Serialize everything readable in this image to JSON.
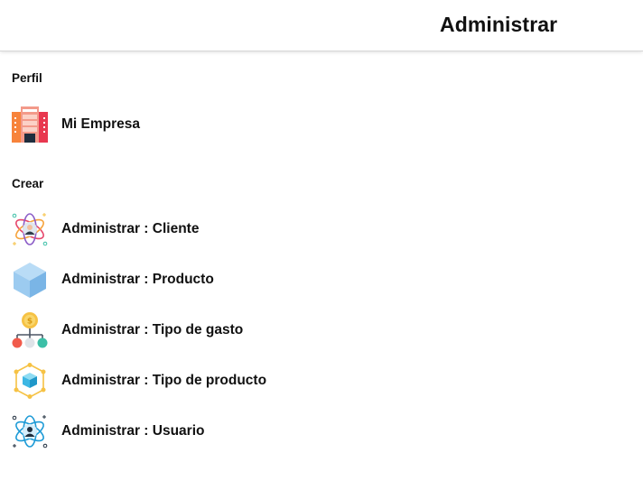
{
  "appbar": {
    "title": "Administrar"
  },
  "sections": {
    "perfil": {
      "header": "Perfil",
      "items": [
        {
          "label": "Mi Empresa",
          "icon": "office-building-icon"
        }
      ]
    },
    "crear": {
      "header": "Crear",
      "items": [
        {
          "label": "Administrar : Cliente",
          "icon": "client-atom-icon"
        },
        {
          "label": "Administrar : Producto",
          "icon": "cube-icon"
        },
        {
          "label": "Administrar : Tipo de gasto",
          "icon": "expense-tree-icon"
        },
        {
          "label": "Administrar : Tipo de producto",
          "icon": "product-network-icon"
        },
        {
          "label": "Administrar : Usuario",
          "icon": "user-atom-icon"
        }
      ]
    }
  },
  "colors": {
    "building_orange": "#f7833b",
    "building_red": "#e8384f",
    "cube_blue": "#8ec3ef",
    "coin_yellow": "#f6c244",
    "node_red": "#f15b4c",
    "node_teal": "#3cbfa7",
    "atom_blue": "#1c9ad6"
  }
}
